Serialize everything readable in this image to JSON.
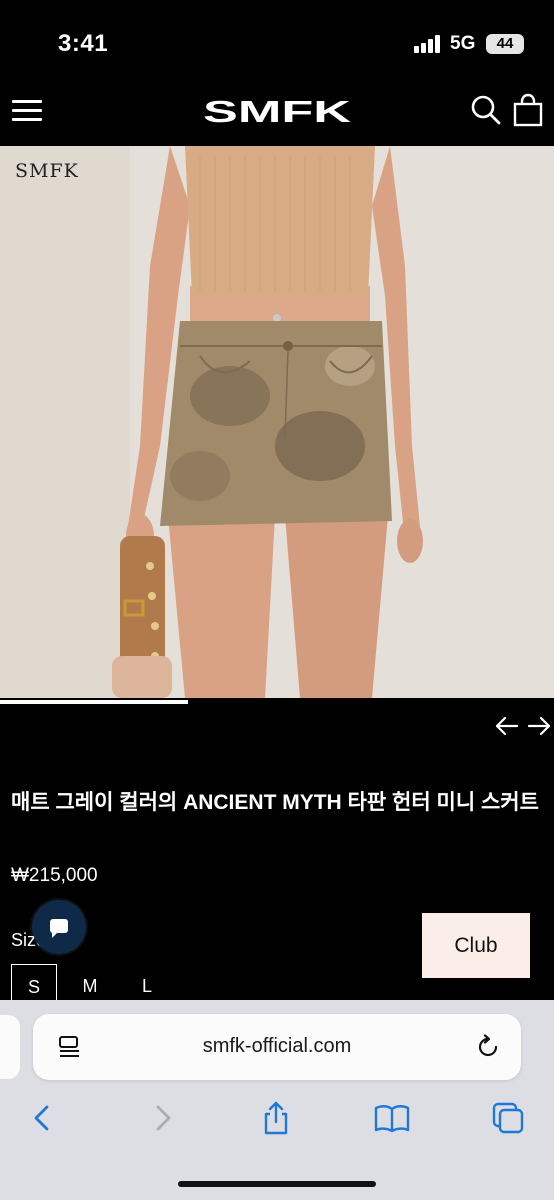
{
  "status_bar": {
    "time": "3:41",
    "network": "5G",
    "battery": "44"
  },
  "header": {
    "logo": "SMFK"
  },
  "hero": {
    "watermark": "SMFK",
    "carousel_progress": 0.34,
    "colors": {
      "background": "#e4dfd8",
      "top": "#d7ab84",
      "skirt": "#a18a6a",
      "skin": "#d9a285",
      "bag": "#b07a4a"
    }
  },
  "product": {
    "title": "매트 그레이 컬러의 ANCIENT MYTH 타판 헌터 미니 스커트",
    "price": "₩215,000",
    "size_label": "Size",
    "sizes": [
      "S",
      "M",
      "L"
    ],
    "selected_size": "S",
    "club_button": "Club"
  },
  "browser": {
    "url": "smfk-official.com"
  },
  "colors": {
    "page_bg": "#000000",
    "accent_bubble": "#0f2a49",
    "club_bg": "#fbeee8",
    "toolbar_blue": "#1f78d6",
    "toolbar_gray": "#a9acb3"
  }
}
